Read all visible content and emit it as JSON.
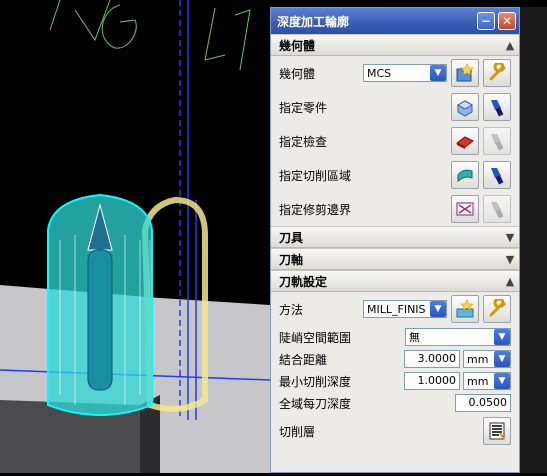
{
  "dialog": {
    "title": "深度加工輪廓",
    "controls": {
      "minimize_icon": "minus",
      "close_icon": "x"
    }
  },
  "sections": {
    "geometry": {
      "label": "幾何體",
      "geometry_label": "幾何體",
      "geometry_value": "MCS",
      "specify_part": "指定零件",
      "specify_check": "指定檢查",
      "specify_cut_area": "指定切削區域",
      "specify_trim_boundary": "指定修剪邊界"
    },
    "tool": {
      "label": "刀具"
    },
    "axis": {
      "label": "刀軸"
    },
    "path_settings": {
      "label": "刀軌設定",
      "method_label": "方法",
      "method_value": "MILL_FINIS",
      "steep_label": "陡峭空間範圍",
      "steep_value": "無",
      "merge_label": "結合距離",
      "merge_value": "3.0000",
      "merge_unit": "mm",
      "min_cut_label": "最小切削深度",
      "min_cut_value": "1.0000",
      "min_cut_unit": "mm",
      "global_depth_label": "全域每刀深度",
      "global_depth_value": "0.0500",
      "cut_levels_label": "切削層"
    }
  },
  "colors": {
    "titlebar": "#3b5cb4",
    "dialog_bg": "#ecebe7",
    "viewport_bg": "#000000",
    "tool_cyan": "#00e5e5",
    "tool_yellow": "#f2e78a",
    "wire_blue": "#1f3cff"
  }
}
